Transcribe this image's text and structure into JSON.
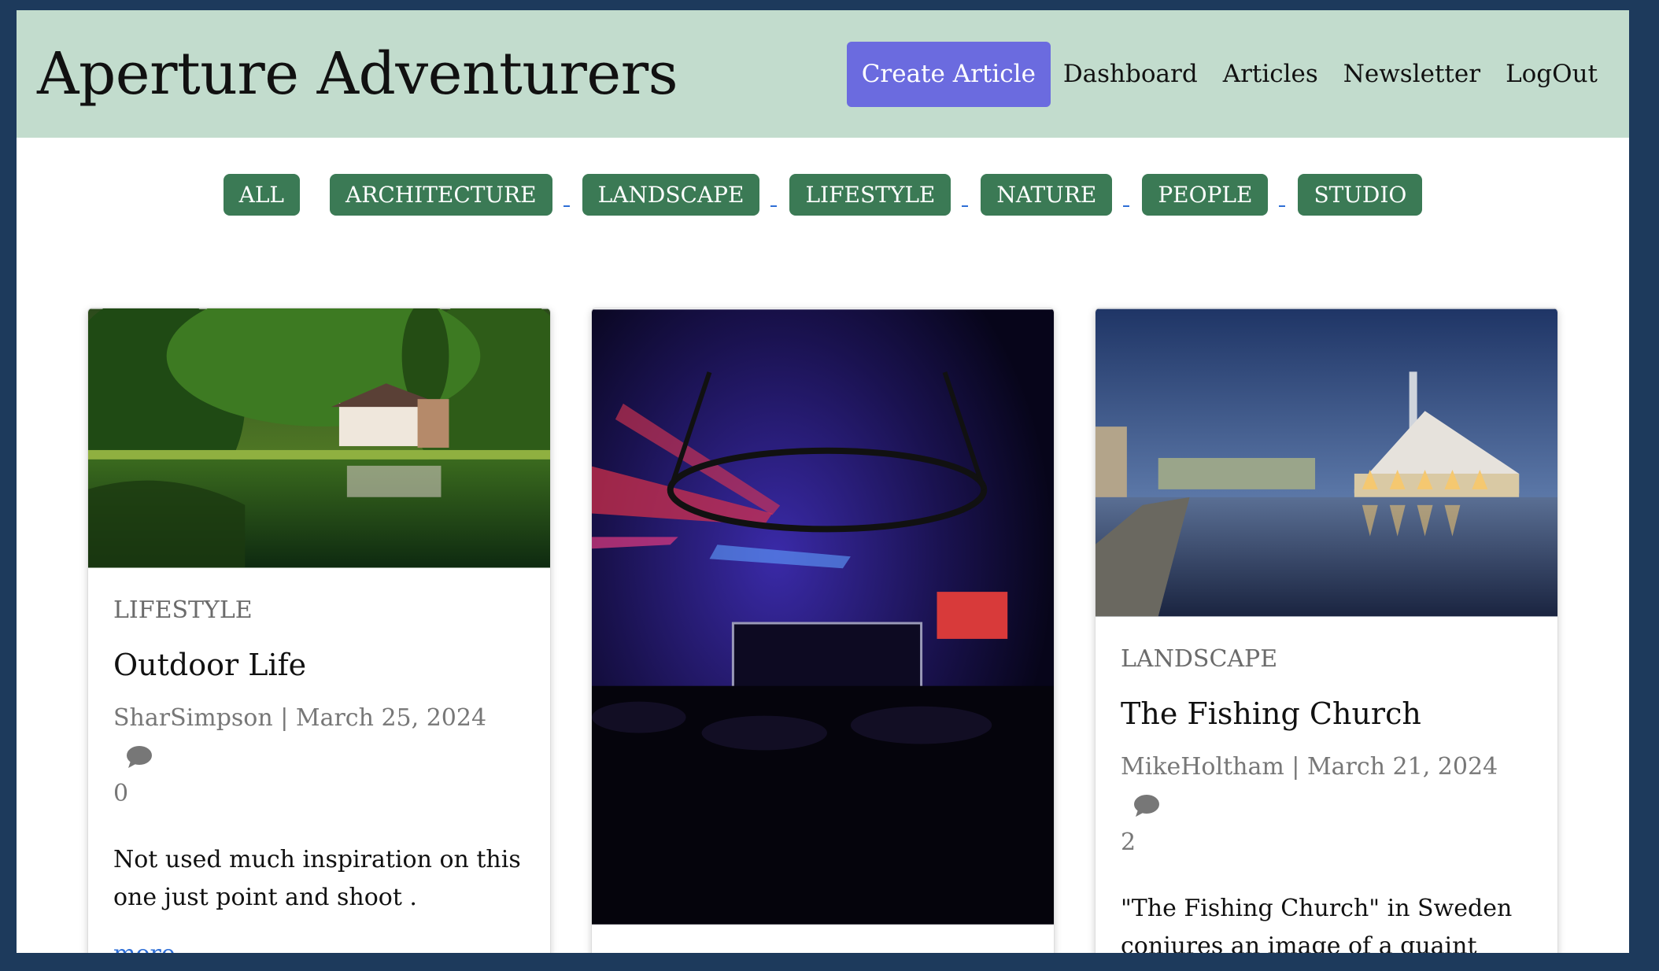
{
  "header": {
    "site_title": "Aperture Adventurers",
    "create_label": "Create Article",
    "nav": [
      "Dashboard",
      "Articles",
      "Newsletter",
      "LogOut"
    ]
  },
  "filters": [
    "ALL",
    "ARCHITECTURE",
    "LANDSCAPE",
    "LIFESTYLE",
    "NATURE",
    "PEOPLE",
    "STUDIO"
  ],
  "cards": [
    {
      "category": "LIFESTYLE",
      "title": "Outdoor Life",
      "meta": "SharSimpson | March 25, 2024",
      "comments": "0",
      "excerpt": "Not used much inspiration on this one just point and shoot .",
      "more": "more...."
    },
    {
      "category": "LANDSCAPE",
      "title": "The Fishing Church",
      "meta": "MikeHoltham | March 21, 2024",
      "comments": "2",
      "excerpt": "\"The Fishing Church\" in Sweden conjures an image of a quaint chapel nestled within a"
    }
  ],
  "colors": {
    "header_bg": "#c2dccd",
    "create_btn": "#6b6bdf",
    "filter_btn": "#3b7a55",
    "link": "#2f6fd6",
    "page_border": "#1d3a5c"
  }
}
